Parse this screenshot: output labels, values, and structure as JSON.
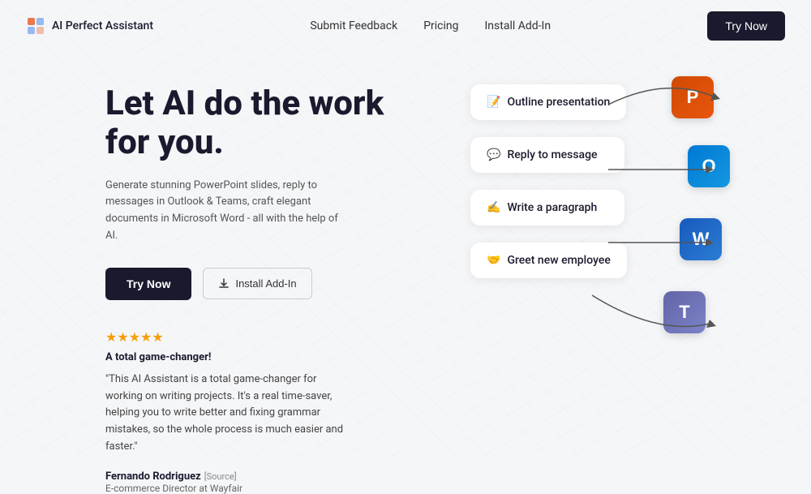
{
  "nav": {
    "logo_text": "AI Perfect Assistant",
    "links": [
      {
        "label": "Submit Feedback",
        "id": "submit-feedback"
      },
      {
        "label": "Pricing",
        "id": "pricing"
      },
      {
        "label": "Install Add-In",
        "id": "install-add-in"
      }
    ],
    "cta_label": "Try Now"
  },
  "hero": {
    "headline_line1": "Let AI do the work",
    "headline_line2": "for you.",
    "subtext": "Generate stunning PowerPoint slides, reply to messages in Outlook & Teams, craft elegant documents in Microsoft Word - all with the help of AI.",
    "try_label": "Try Now",
    "install_label": "Install Add-In"
  },
  "review": {
    "stars": "★★★★★",
    "title": "A total game-changer!",
    "text": "\"This AI Assistant is a total game-changer for working on writing projects. It's a real time-saver, helping you to write better and fixing grammar mistakes, so the whole process is much easier and faster.\"",
    "reviewer_name": "Fernando Rodriguez",
    "reviewer_source": "[Source]",
    "reviewer_job": "E-commerce Director at Wayfair"
  },
  "features": [
    {
      "emoji": "📝",
      "label": "Outline presentation",
      "id": "card-outline"
    },
    {
      "emoji": "💬",
      "label": "Reply to message",
      "id": "card-reply"
    },
    {
      "emoji": "✍️",
      "label": "Write a paragraph",
      "id": "card-write"
    },
    {
      "emoji": "🤝",
      "label": "Greet new employee",
      "id": "card-greet"
    }
  ],
  "apps": [
    {
      "name": "PowerPoint",
      "letter": "P",
      "class": "ms-powerpoint"
    },
    {
      "name": "Outlook",
      "letter": "O",
      "class": "ms-outlook"
    },
    {
      "name": "Word",
      "letter": "W",
      "class": "ms-word"
    },
    {
      "name": "Teams",
      "letter": "T",
      "class": "ms-teams"
    }
  ]
}
